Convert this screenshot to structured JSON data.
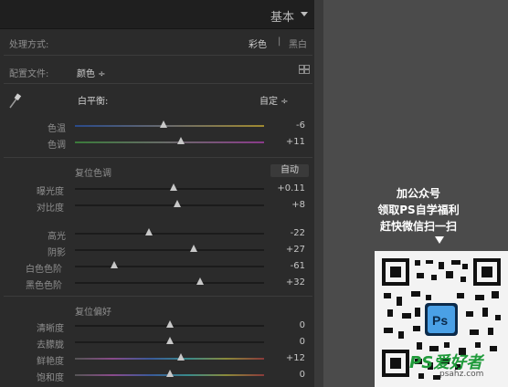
{
  "panel": {
    "title": "基本"
  },
  "treatment": {
    "label": "处理方式:",
    "color": "彩色",
    "divider": "|",
    "bw": "黑白"
  },
  "profile": {
    "label": "配置文件:",
    "value": "颜色 ÷"
  },
  "wb": {
    "label": "白平衡:",
    "value": "自定 ÷"
  },
  "wb_sliders": [
    {
      "label": "色温",
      "value": "-6",
      "level": 0.47
    },
    {
      "label": "色调",
      "value": "+11",
      "level": 0.56
    }
  ],
  "tone": {
    "label": "复位色调",
    "auto": "自动"
  },
  "tone_sliders": [
    {
      "label": "曝光度",
      "value": "+0.11",
      "level": 0.52
    },
    {
      "label": "对比度",
      "value": "+8",
      "level": 0.54
    }
  ],
  "tone_sliders2": [
    {
      "label": "高光",
      "value": "-22",
      "level": 0.39
    },
    {
      "label": "阴影",
      "value": "+27",
      "level": 0.63
    },
    {
      "label": "白色色阶",
      "value": "-61",
      "level": 0.21
    },
    {
      "label": "黑色色阶",
      "value": "+32",
      "level": 0.66
    }
  ],
  "presence": {
    "label": "复位偏好"
  },
  "presence_sliders": [
    {
      "label": "清晰度",
      "value": "0",
      "level": 0.5
    },
    {
      "label": "去朦胧",
      "value": "0",
      "level": 0.5
    },
    {
      "label": "鲜艳度",
      "value": "+12",
      "level": 0.56
    },
    {
      "label": "饱和度",
      "value": "0",
      "level": 0.5
    }
  ],
  "promo": {
    "line1": "加公众号",
    "line2": "领取PS自学福利",
    "line3": "赶快微信扫一扫",
    "ps_badge": "Ps",
    "watermark": "PS爱好者",
    "watermark_url": "psahz.com"
  }
}
